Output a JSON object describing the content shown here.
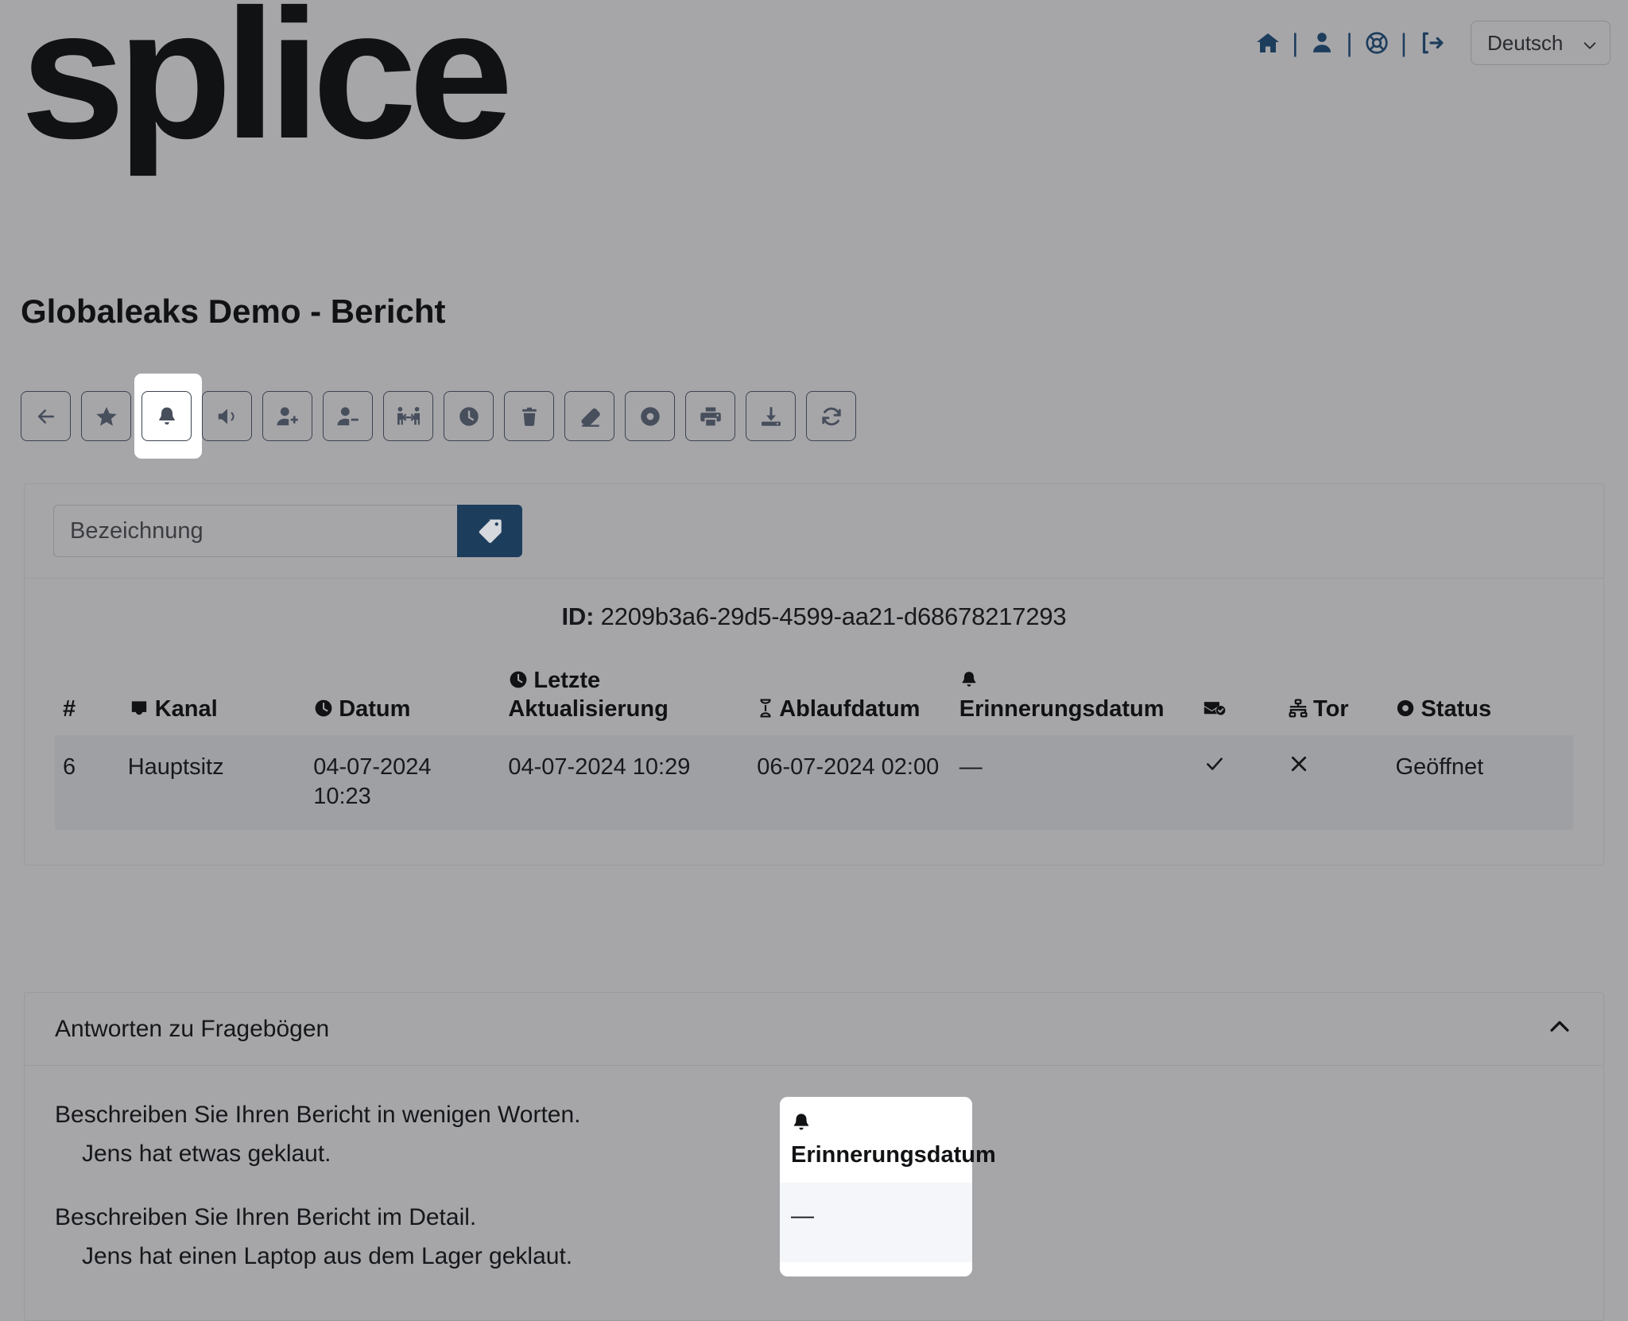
{
  "header": {
    "logo_text": "splice",
    "icons": [
      {
        "name": "home-icon",
        "label": "Home"
      },
      {
        "name": "user-icon",
        "label": "Account"
      },
      {
        "name": "life-ring-icon",
        "label": "Support"
      },
      {
        "name": "logout-icon",
        "label": "Logout"
      }
    ],
    "separator": "|",
    "language": {
      "selected": "Deutsch",
      "options": [
        "Deutsch"
      ]
    }
  },
  "page_title": "Globaleaks Demo - Bericht",
  "toolbar": {
    "buttons": [
      {
        "name": "back-button",
        "icon": "arrow-left-icon",
        "active": false
      },
      {
        "name": "star-button",
        "icon": "star-icon",
        "active": false
      },
      {
        "name": "reminder-button",
        "icon": "bell-icon",
        "active": true
      },
      {
        "name": "announce-button",
        "icon": "megaphone-icon",
        "active": false
      },
      {
        "name": "add-recipient-button",
        "icon": "user-plus-icon",
        "active": false
      },
      {
        "name": "remove-recipient-button",
        "icon": "user-minus-icon",
        "active": false
      },
      {
        "name": "transfer-button",
        "icon": "people-transfer-icon",
        "active": false
      },
      {
        "name": "postpone-button",
        "icon": "clock-icon",
        "active": false
      },
      {
        "name": "delete-button",
        "icon": "trash-icon",
        "active": false
      },
      {
        "name": "redact-button",
        "icon": "eraser-icon",
        "active": false
      },
      {
        "name": "status-button",
        "icon": "circle-dot-icon",
        "active": false
      },
      {
        "name": "print-button",
        "icon": "printer-icon",
        "active": false
      },
      {
        "name": "download-button",
        "icon": "download-icon",
        "active": false
      },
      {
        "name": "refresh-button",
        "icon": "refresh-icon",
        "active": false
      }
    ]
  },
  "label_panel": {
    "input_placeholder": "Bezeichnung",
    "input_value": "",
    "tag_button_icon": "tag-icon"
  },
  "report": {
    "id_label": "ID:",
    "id_value": "2209b3a6-29d5-4599-aa21-d68678217293",
    "columns": [
      {
        "key": "num",
        "label": "#",
        "icon": ""
      },
      {
        "key": "channel",
        "label": "Kanal",
        "icon": "inbox-icon"
      },
      {
        "key": "date",
        "label": "Datum",
        "icon": "clock-icon"
      },
      {
        "key": "updated",
        "label": "Letzte Aktualisierung",
        "icon": "clock-icon"
      },
      {
        "key": "expiry",
        "label": "Ablaufdatum",
        "icon": "hourglass-icon"
      },
      {
        "key": "reminder",
        "label": "Erinnerungsdatum",
        "icon": "bell-icon"
      },
      {
        "key": "mail",
        "label": "",
        "icon": "mail-check-icon"
      },
      {
        "key": "tor",
        "label": "Tor",
        "icon": "sitemap-icon"
      },
      {
        "key": "status",
        "label": "Status",
        "icon": "circle-dot-icon"
      }
    ],
    "rows": [
      {
        "num": "6",
        "channel": "Hauptsitz",
        "date": "04-07-2024 10:23",
        "updated": "04-07-2024 10:29",
        "expiry": "06-07-2024 02:00",
        "reminder": "—",
        "mail": "check-icon",
        "tor": "x-icon",
        "status": "Geöffnet"
      }
    ],
    "highlighted_column": "reminder"
  },
  "questionnaire": {
    "section_title": "Antworten zu Fragebögen",
    "collapse_icon": "chevron-up-icon",
    "expanded": true,
    "entries": [
      {
        "question": "Beschreiben Sie Ihren Bericht in wenigen Worten.",
        "answer": "Jens hat etwas geklaut."
      },
      {
        "question": "Beschreiben Sie Ihren Bericht im Detail.",
        "answer": "Jens hat einen Laptop aus dem Lager geklaut."
      }
    ]
  },
  "colors": {
    "page_bg": "#a6a6a9",
    "accent_blue": "#1d3d5c",
    "icon_gray": "#474e5c",
    "row_bg": "#9fa0a3",
    "highlight_bg": "#f4f6f9"
  }
}
